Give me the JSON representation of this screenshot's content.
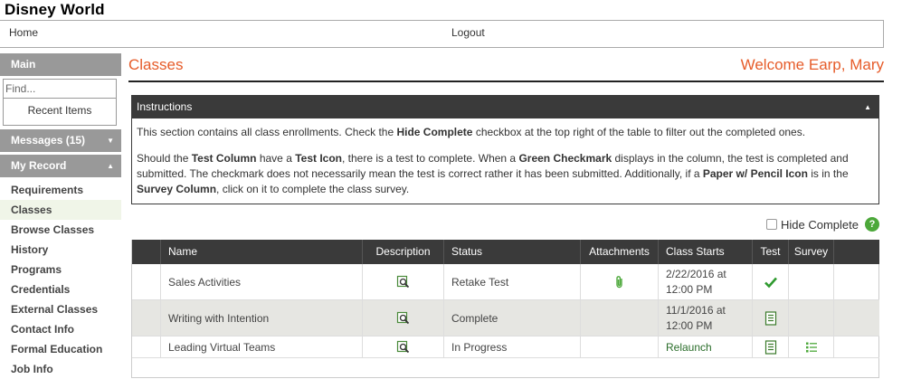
{
  "app": {
    "title": "Disney World"
  },
  "topnav": {
    "home": "Home",
    "logout": "Logout"
  },
  "sidebar": {
    "main_label": "Main",
    "search_placeholder": "Find...",
    "recent_items": "Recent Items",
    "messages_label": "Messages (15)",
    "my_record_label": "My Record",
    "items": [
      {
        "label": "Requirements"
      },
      {
        "label": "Classes"
      },
      {
        "label": "Browse Classes"
      },
      {
        "label": "History"
      },
      {
        "label": "Programs"
      },
      {
        "label": "Credentials"
      },
      {
        "label": "External Classes"
      },
      {
        "label": "Contact Info"
      },
      {
        "label": "Formal Education"
      },
      {
        "label": "Job Info"
      }
    ]
  },
  "page": {
    "title": "Classes",
    "welcome": "Welcome Earp, Mary"
  },
  "instructions": {
    "header": "Instructions",
    "p1_a": "This section contains all class enrollments.  Check the ",
    "p1_b": "Hide Complete",
    "p1_c": " checkbox at the top right of the table to filter out the completed ones.",
    "p2_a": "Should the ",
    "p2_b": "Test Column",
    "p2_c": " have a ",
    "p2_d": "Test Icon",
    "p2_e": ", there is a test to complete.  When a ",
    "p2_f": "Green Checkmark",
    "p2_g": " displays in the column, the test is completed and submitted.  The checkmark does not necessarily mean the test is correct rather it has been submitted. Additionally, if a ",
    "p2_h": "Paper w/ Pencil Icon",
    "p2_i": " is in the ",
    "p2_j": "Survey Column",
    "p2_k": ", click on it to complete the class survey."
  },
  "hide_complete": {
    "label": "Hide Complete",
    "help": "?"
  },
  "table": {
    "headers": {
      "name": "Name",
      "description": "Description",
      "status": "Status",
      "attachments": "Attachments",
      "class_starts": "Class Starts",
      "test": "Test",
      "survey": "Survey"
    },
    "rows": [
      {
        "name": "Sales Activities",
        "status": "Retake Test",
        "date": "2/22/2016 at",
        "time": "12:00 PM",
        "attachment": "paperclip-icon",
        "test": "checkmark-icon",
        "survey": ""
      },
      {
        "name": "Writing with Intention",
        "status": "Complete",
        "date": "11/1/2016 at",
        "time": "12:00 PM",
        "attachment": "",
        "test": "test-icon",
        "survey": ""
      },
      {
        "name": "Leading Virtual Teams",
        "status": "In Progress",
        "date": "Relaunch",
        "attachment": "",
        "test": "test-icon",
        "survey": "survey-icon"
      }
    ]
  },
  "colors": {
    "accent": "#e65c2a",
    "green": "#4ca83a",
    "header_dark": "#3a3a3a",
    "sidebar_head": "#999999"
  }
}
